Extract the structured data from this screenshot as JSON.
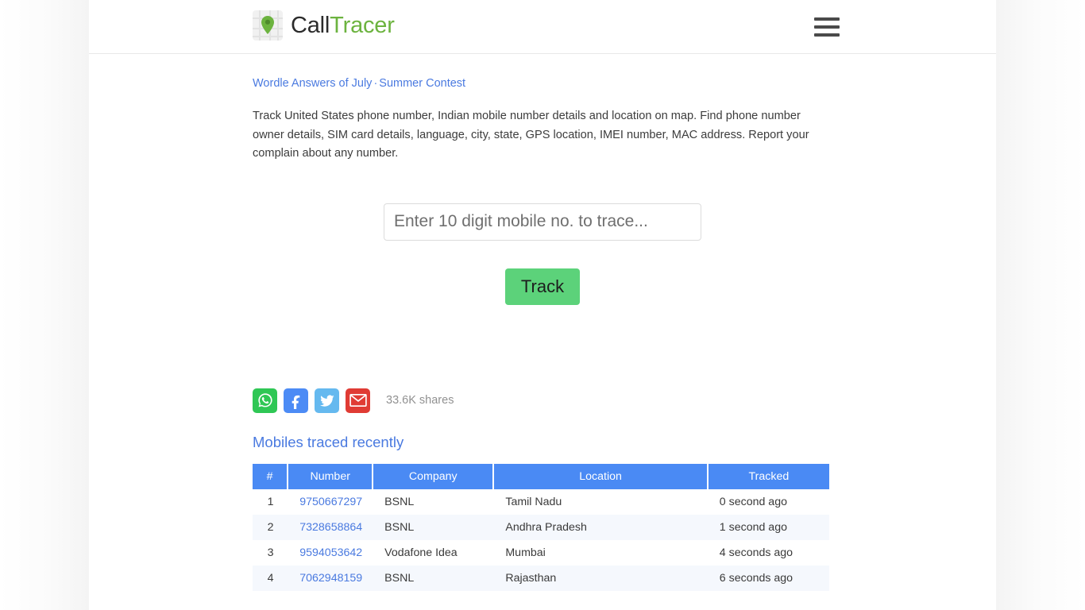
{
  "header": {
    "brand_primary": "Call",
    "brand_secondary": "Tracer",
    "logo_icon": "map-pin-icon",
    "menu_icon": "hamburger-menu-icon"
  },
  "toplinks": {
    "link1": "Wordle Answers of July",
    "separator": "·",
    "link2": "Summer Contest"
  },
  "intro": {
    "text": "Track United States phone number, Indian mobile number details and location on map. Find phone number owner details, SIM card details, language, city, state, GPS location, IMEI number, MAC address. Report your complain about any number."
  },
  "search": {
    "placeholder": "Enter 10 digit mobile no. to trace...",
    "value": "",
    "button_label": "Track"
  },
  "share": {
    "count_label": "33.6K shares",
    "items": [
      {
        "name": "whatsapp",
        "icon": "whatsapp-icon",
        "color": "#2fc755"
      },
      {
        "name": "facebook",
        "icon": "facebook-icon",
        "color": "#4c8bf5"
      },
      {
        "name": "twitter",
        "icon": "twitter-icon",
        "color": "#65b9ef"
      },
      {
        "name": "email",
        "icon": "email-icon",
        "color": "#e03b34"
      }
    ]
  },
  "recent": {
    "title": "Mobiles traced recently",
    "columns": [
      "#",
      "Number",
      "Company",
      "Location",
      "Tracked"
    ],
    "rows": [
      {
        "idx": "1",
        "number": "9750667297",
        "company": "BSNL",
        "location": "Tamil Nadu",
        "tracked": "0 second ago"
      },
      {
        "idx": "2",
        "number": "7328658864",
        "company": "BSNL",
        "location": "Andhra Pradesh",
        "tracked": "1 second ago"
      },
      {
        "idx": "3",
        "number": "9594053642",
        "company": "Vodafone Idea",
        "location": "Mumbai",
        "tracked": "4 seconds ago"
      },
      {
        "idx": "4",
        "number": "7062948159",
        "company": "BSNL",
        "location": "Rajasthan",
        "tracked": "6 seconds ago"
      }
    ]
  },
  "colors": {
    "brand_green": "#6cb33f",
    "link_blue": "#4a7ae0",
    "table_header_blue": "#4a8af4",
    "track_button_green": "#5cd27a"
  }
}
